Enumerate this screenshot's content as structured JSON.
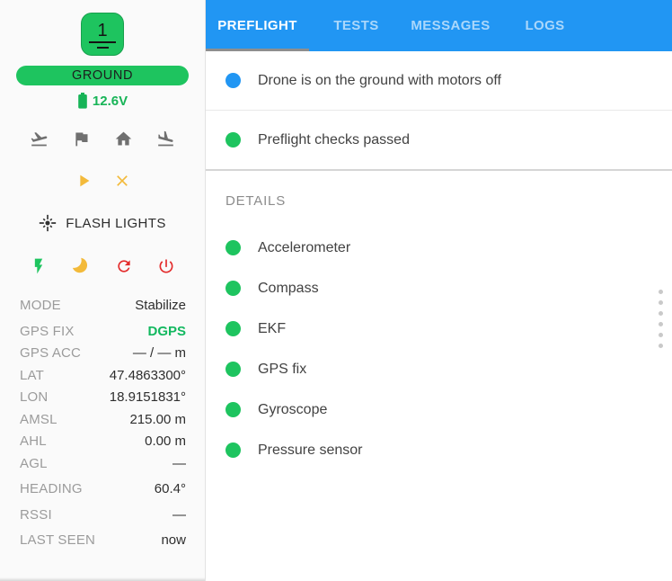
{
  "colors": {
    "green": "#1ec45f",
    "blue": "#2196f3",
    "amber": "#f3ba3a",
    "red": "#e32b2b",
    "icon_gray": "#6f6f6f",
    "tab_bar_blue": "#2196f3",
    "tab_indicator_gray": "#8e8e8e"
  },
  "sidebar": {
    "drone_id": "1",
    "status_badge": "GROUND",
    "battery_voltage": "12.6V",
    "flash_lights_label": "FLASH LIGHTS",
    "icons": {
      "takeoff": "flight-takeoff",
      "flag": "flag",
      "home": "home",
      "land": "flight-land",
      "play": "▶",
      "cancel": "✕",
      "brightness": "☀",
      "flash": "⚡",
      "sleep": "☾",
      "reboot": "⟳",
      "power": "⏻",
      "battery": "battery"
    },
    "telemetry": [
      {
        "label": "MODE",
        "value": "Stabilize"
      },
      {
        "label": "GPS FIX",
        "value": "DGPS"
      },
      {
        "label": "GPS ACC",
        "value": "— / — m"
      },
      {
        "label": "LAT",
        "value": "47.4863300°"
      },
      {
        "label": "LON",
        "value": "18.9151831°"
      },
      {
        "label": "AMSL",
        "value": "215.00 m"
      },
      {
        "label": "AHL",
        "value": "0.00 m"
      },
      {
        "label": "AGL",
        "value": "—"
      },
      {
        "label": "HEADING",
        "value": "60.4°"
      },
      {
        "label": "RSSI",
        "value": "—"
      },
      {
        "label": "LAST SEEN",
        "value": "now"
      }
    ]
  },
  "panel": {
    "tabs": [
      {
        "label": "PREFLIGHT",
        "active": true
      },
      {
        "label": "TESTS",
        "active": false
      },
      {
        "label": "MESSAGES",
        "active": false
      },
      {
        "label": "LOGS",
        "active": false
      }
    ],
    "statuses": [
      {
        "text": "Drone is on the ground with motors off",
        "dot": "blue"
      },
      {
        "text": "Preflight checks passed",
        "dot": "green"
      }
    ],
    "details_heading": "DETAILS",
    "details": [
      {
        "text": "Accelerometer",
        "dot": "green"
      },
      {
        "text": "Compass",
        "dot": "green"
      },
      {
        "text": "EKF",
        "dot": "green"
      },
      {
        "text": "GPS fix",
        "dot": "green"
      },
      {
        "text": "Gyroscope",
        "dot": "green"
      },
      {
        "text": "Pressure sensor",
        "dot": "green"
      }
    ]
  }
}
